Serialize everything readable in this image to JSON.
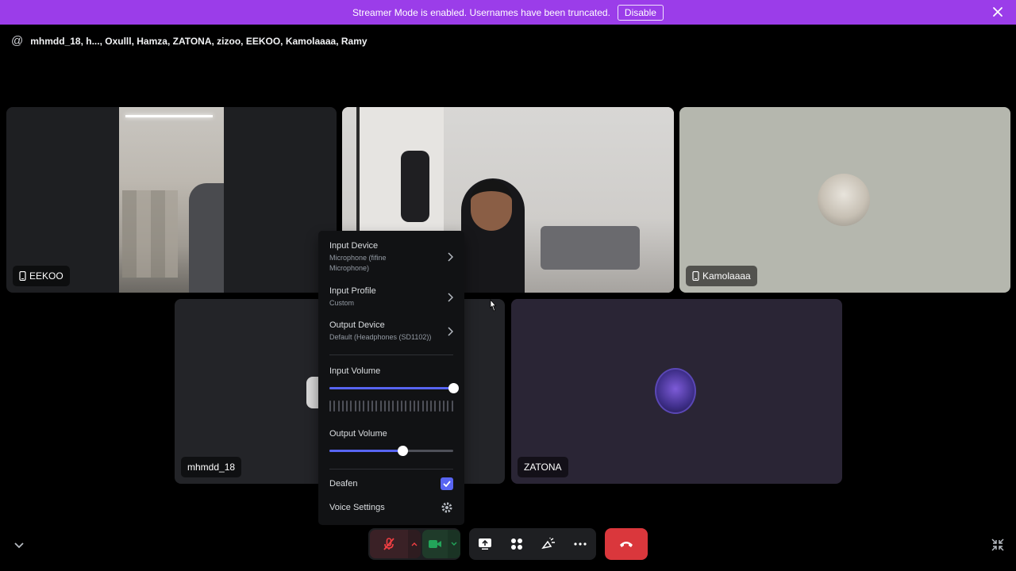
{
  "banner": {
    "text": "Streamer Mode is enabled. Usernames have been truncated.",
    "button_label": "Disable"
  },
  "header": {
    "title": "mhmdd_18, h..., Oxulll, Hamza, ZATONA, zizoo, EEKOO, Kamolaaaa, Ramy"
  },
  "tiles": {
    "eekoo": "EEKOO",
    "kamolaaaa": "Kamolaaaa",
    "mhmdd": "mhmdd_18",
    "zatona": "ZATONA"
  },
  "menu": {
    "input_device": {
      "title": "Input Device",
      "subtitle": "Microphone (fifine Microphone)"
    },
    "input_profile": {
      "title": "Input Profile",
      "subtitle": "Custom"
    },
    "output_device": {
      "title": "Output Device",
      "subtitle": "Default (Headphones (SD1102))"
    },
    "input_volume": {
      "label": "Input Volume",
      "value": 1.0
    },
    "output_volume": {
      "label": "Output Volume",
      "value": 0.59
    },
    "deafen": {
      "label": "Deafen",
      "checked": true
    },
    "voice_settings": {
      "label": "Voice Settings"
    }
  },
  "colors": {
    "banner": "#9b3de9",
    "accent": "#5865f2",
    "hangup": "#da373c",
    "camera_on": "#23a55a",
    "mic_muted": "#f23f43"
  },
  "icons": [
    "at-icon",
    "close-icon",
    "phone-icon",
    "chevron-right-icon",
    "checkmark-icon",
    "gear-icon",
    "mic-muted-icon",
    "camera-icon",
    "screen-share-icon",
    "activities-icon",
    "soundboard-icon",
    "more-icon",
    "hangup-icon",
    "chevron-down-icon",
    "minimize-icon"
  ]
}
